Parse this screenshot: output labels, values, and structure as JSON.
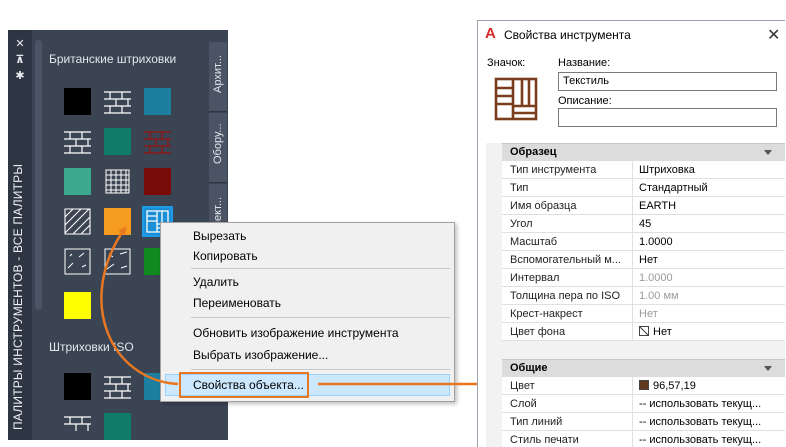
{
  "palette": {
    "title": "ПАЛИТРЫ ИНСТРУМЕНТОВ - ВСЕ ПАЛИТРЫ",
    "section1": "Британские штриховки",
    "section2": "Штриховки ISO",
    "tabs": [
      "Архит...",
      "Обору...",
      "Элект..."
    ],
    "buttons": {
      "close": "✕",
      "autohide": "⊼",
      "properties": "✱"
    }
  },
  "context_menu": {
    "items": [
      "Вырезать",
      "Копировать",
      "Удалить",
      "Переименовать",
      "Обновить изображение инструмента",
      "Выбрать изображение...",
      "Свойства объекта..."
    ]
  },
  "dialog": {
    "title": "Свойства инструмента",
    "icon_label": "Значок:",
    "name_label": "Название:",
    "name_value": "Текстиль",
    "desc_label": "Описание:",
    "desc_value": "",
    "cat_sample": "Образец",
    "cat_general": "Общие",
    "sample_rows": [
      {
        "k": "Тип инструмента",
        "v": "Штриховка"
      },
      {
        "k": "Тип",
        "v": "Стандартный"
      },
      {
        "k": "Имя образца",
        "v": "EARTH"
      },
      {
        "k": "Угол",
        "v": "45"
      },
      {
        "k": "Масштаб",
        "v": "1.0000"
      },
      {
        "k": "Вспомогательный м...",
        "v": "Нет"
      },
      {
        "k": "Интервал",
        "v": "1.0000"
      },
      {
        "k": "Толщина пера по ISO",
        "v": "1.00 мм"
      },
      {
        "k": "Крест-накрест",
        "v": "Нет"
      },
      {
        "k": "Цвет фона",
        "v": "Нет"
      }
    ],
    "general_rows": [
      {
        "k": "Цвет",
        "v": "96,57,19"
      },
      {
        "k": "Слой",
        "v": "-- использовать текущ..."
      },
      {
        "k": "Тип линий",
        "v": "-- использовать текущ..."
      },
      {
        "k": "Стиль печати",
        "v": "-- использовать текущ..."
      }
    ],
    "colors": {
      "fill_color": "#60391f"
    }
  }
}
